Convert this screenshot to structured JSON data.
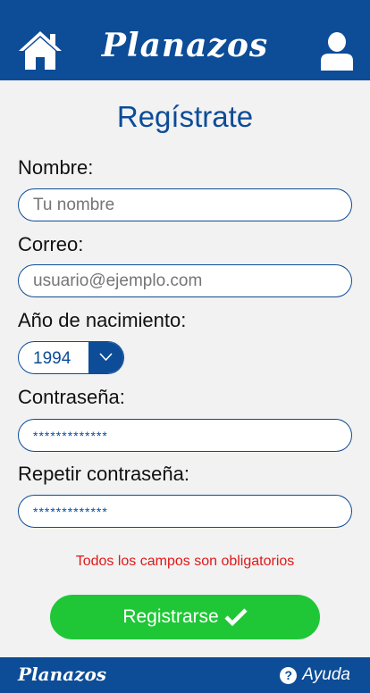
{
  "header": {
    "brand": "Planazos",
    "home_icon": "home-icon",
    "user_icon": "user-icon"
  },
  "form": {
    "title": "Regístrate",
    "name_label": "Nombre:",
    "name_placeholder": "Tu nombre",
    "email_label": "Correo:",
    "email_placeholder": "usuario@ejemplo.com",
    "birth_year_label": "Año de nacimiento:",
    "birth_year_value": "1994",
    "password_label": "Contraseña:",
    "password_value": "*************",
    "repeat_password_label": "Repetir contraseña:",
    "repeat_password_value": "*************",
    "error_message": "Todos los campos son obligatorios",
    "submit_label": "Registrarse"
  },
  "footer": {
    "brand": "Planazos",
    "help_label": "Ayuda"
  },
  "colors": {
    "primary": "#0d4c97",
    "success": "#1fc737",
    "error": "#e01818",
    "background": "#f2f2f2"
  }
}
